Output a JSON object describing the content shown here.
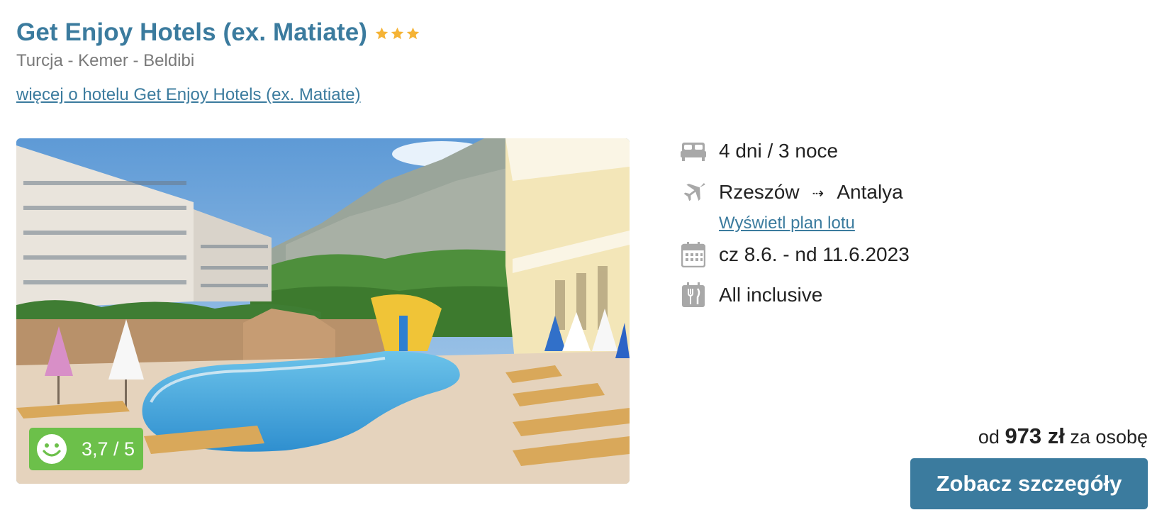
{
  "hotel": {
    "name": "Get Enjoy Hotels (ex. Matiate)",
    "stars": 3,
    "location": "Turcja - Kemer - Beldibi",
    "more_link": "więcej o hotelu Get Enjoy Hotels (ex. Matiate)"
  },
  "rating": {
    "value": "3,7 / 5",
    "icon": "smiley-icon"
  },
  "details": {
    "duration": "4 dni / 3 noce",
    "from": "Rzeszów",
    "arrow": "⇢",
    "to": "Antalya",
    "flight_link": "Wyświetl plan lotu",
    "dates": "cz 8.6. - nd 11.6.2023",
    "board": "All inclusive"
  },
  "price": {
    "prefix": "od",
    "amount": "973 zł",
    "suffix": "za osobę"
  },
  "cta": {
    "label": "Zobacz szczegóły"
  },
  "colors": {
    "brand": "#3b7b9e",
    "star": "#f5b335",
    "rating": "#6cc04a",
    "icon_gray": "#a8a8a8"
  }
}
